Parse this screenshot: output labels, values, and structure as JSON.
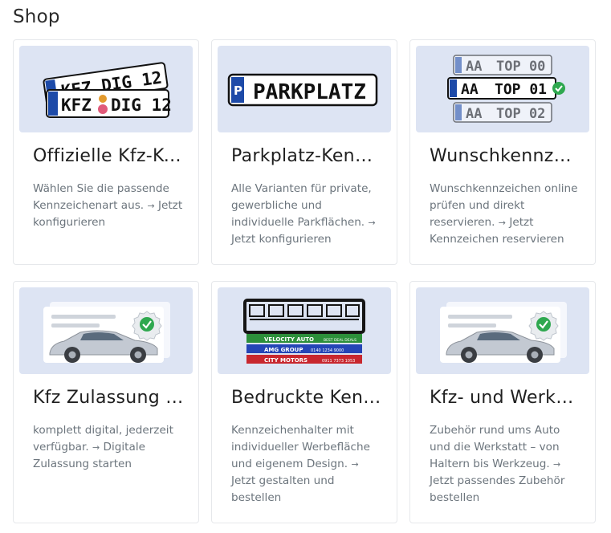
{
  "page": {
    "title": "Shop"
  },
  "cards": [
    {
      "title": "Offizielle Kfz-Kennzeichen",
      "description": "Wählen Sie die passende Kennzeichenart aus.",
      "link": "Jetzt konfigurieren",
      "image": {
        "icon": "license-plates",
        "plate_back": "KFZ DIG 12",
        "plate_front_left": "KFZ",
        "plate_front_right": "DIG 12"
      }
    },
    {
      "title": "Parkplatz-Kennzeichen",
      "description": "Alle Varianten für private, gewerbliche und individuelle Parkflächen.",
      "link": "Jetzt konfigurieren",
      "image": {
        "icon": "parking-plate",
        "badge": "P",
        "plate": "PARKPLATZ"
      }
    },
    {
      "title": "Wunschkennzeichen",
      "description": "Wunschkennzeichen online prüfen und direkt reservieren.",
      "link": "Jetzt Kennzeichen reservieren",
      "image": {
        "icon": "plate-selection",
        "plates": [
          {
            "left": "AA",
            "right": "TOP 00"
          },
          {
            "left": "AA",
            "right": "TOP 01"
          },
          {
            "left": "AA",
            "right": "TOP 02"
          }
        ]
      }
    },
    {
      "title": "Kfz Zulassung online",
      "description": "komplett digital, jederzeit verfügbar.",
      "link": "Digitale Zulassung starten",
      "image": {
        "icon": "car-document-check"
      }
    },
    {
      "title": "Bedruckte Kennzeichenhalter",
      "description": "Kennzeichenhalter mit individueller Werbefläche und eigenem Design.",
      "link": "Jetzt gestalten und bestellen",
      "image": {
        "icon": "plate-holders",
        "strip_1": "VELOCITY AUTO",
        "strip_1_sub": "BEST DEAL DEALS",
        "strip_2": "AMG GROUP",
        "strip_2_sub": "0140 1234 9000",
        "strip_3": "CITY MOTORS",
        "strip_3_sub": "0911 7373 1053"
      }
    },
    {
      "title": "Kfz- und Werkstattbedarf",
      "description": "Zubehör rund ums Auto und die Werkstatt – von Haltern bis Werkzeug.",
      "link": "Jetzt passendes Zubehör bestellen",
      "image": {
        "icon": "car-document-check"
      }
    }
  ],
  "colors": {
    "thumb_bg": "#dde4f3",
    "eu_blue": "#1d4aa8",
    "check_green": "#2fa84f",
    "car_body": "#c3c9d2"
  }
}
